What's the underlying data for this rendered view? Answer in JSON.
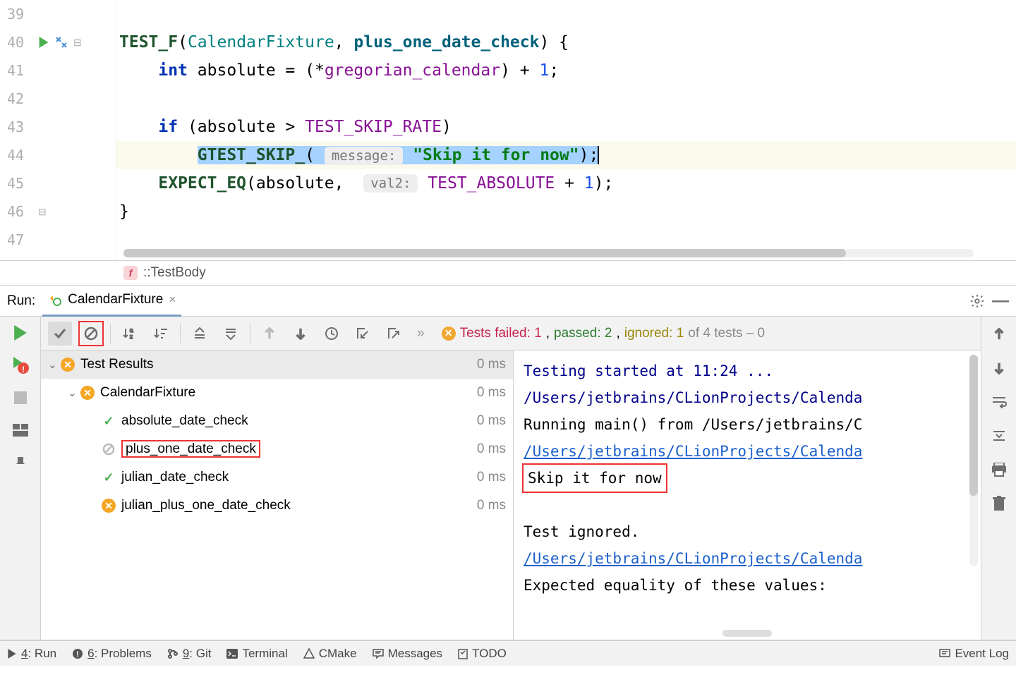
{
  "editor": {
    "lines": [
      {
        "num": "39",
        "indent": "",
        "tokens": []
      },
      {
        "num": "40",
        "indent": "",
        "icons": [
          "run",
          "recompile"
        ],
        "fold": true,
        "tokens": [
          {
            "t": "TEST_F",
            "cls": "kw-macro"
          },
          {
            "t": "("
          },
          {
            "t": "CalendarFixture",
            "cls": "kw-teal"
          },
          {
            "t": ", "
          },
          {
            "t": "plus_one_date_check",
            "cls": "kw-green"
          },
          {
            "t": ") {"
          }
        ]
      },
      {
        "num": "41",
        "indent": "    ",
        "tokens": [
          {
            "t": "int",
            "cls": "kw-blue"
          },
          {
            "t": " absolute = (*"
          },
          {
            "t": "gregorian_calendar",
            "cls": "kw-purple"
          },
          {
            "t": ") + "
          },
          {
            "t": "1",
            "cls": "kw-num"
          },
          {
            "t": ";"
          }
        ]
      },
      {
        "num": "42",
        "indent": "",
        "tokens": []
      },
      {
        "num": "43",
        "indent": "    ",
        "tokens": [
          {
            "t": "if",
            "cls": "kw-blue"
          },
          {
            "t": " (absolute > "
          },
          {
            "t": "TEST_SKIP_RATE",
            "cls": "kw-purple"
          },
          {
            "t": ")"
          }
        ]
      },
      {
        "num": "44",
        "highlight": true,
        "indent": "        ",
        "tokens": [
          {
            "sel": true,
            "content": [
              {
                "t": "GTEST_SKIP_",
                "cls": "kw-macro"
              },
              {
                "t": "( "
              },
              {
                "hint": "message:"
              },
              {
                "t": " "
              },
              {
                "t": "\"Skip it for now\"",
                "cls": "kw-str"
              },
              {
                "t": ");"
              }
            ]
          },
          {
            "caret": true
          }
        ]
      },
      {
        "num": "45",
        "indent": "    ",
        "tokens": [
          {
            "t": "EXPECT_EQ",
            "cls": "kw-macro"
          },
          {
            "t": "(absolute,  "
          },
          {
            "hint": "val2:"
          },
          {
            "t": " "
          },
          {
            "t": "TEST_ABSOLUTE",
            "cls": "kw-purple"
          },
          {
            "t": " + "
          },
          {
            "t": "1",
            "cls": "kw-num"
          },
          {
            "t": ");"
          }
        ]
      },
      {
        "num": "46",
        "indent": "",
        "fold_close": true,
        "tokens": [
          {
            "t": "}"
          }
        ]
      },
      {
        "num": "47",
        "indent": "",
        "tokens": []
      }
    ]
  },
  "breadcrumb": {
    "label": "::TestBody"
  },
  "run": {
    "label": "Run:",
    "tab_name": "CalendarFixture",
    "status": {
      "failed_label": "Tests failed:",
      "failed": "1",
      "passed_label": "passed:",
      "passed": "2",
      "ignored_label": "ignored:",
      "ignored": "1",
      "total_suffix": "of 4 tests – 0"
    },
    "tree": {
      "root": {
        "label": "Test Results",
        "time": "0 ms"
      },
      "suite": {
        "label": "CalendarFixture",
        "time": "0 ms"
      },
      "tests": [
        {
          "name": "absolute_date_check",
          "status": "pass",
          "time": "0 ms"
        },
        {
          "name": "plus_one_date_check",
          "status": "skip",
          "time": "0 ms",
          "highlight": true
        },
        {
          "name": "julian_date_check",
          "status": "pass",
          "time": "0 ms"
        },
        {
          "name": "julian_plus_one_date_check",
          "status": "fail",
          "time": "0 ms"
        }
      ]
    },
    "console": {
      "lines": [
        {
          "text": "Testing started at 11:24 ...",
          "cls": "navyline"
        },
        {
          "text": "/Users/jetbrains/CLionProjects/Calenda",
          "cls": "navyline"
        },
        {
          "text": "Running main() from /Users/jetbrains/C"
        },
        {
          "text": "/Users/jetbrains/CLionProjects/Calenda",
          "cls": "link"
        },
        {
          "text": "Skip it for now",
          "redbox": true
        },
        {
          "text": ""
        },
        {
          "text": "Test ignored."
        },
        {
          "text": "/Users/jetbrains/CLionProjects/Calenda",
          "cls": "link"
        },
        {
          "text": "Expected equality of these values:"
        }
      ]
    }
  },
  "bottom_bar": {
    "items": [
      {
        "icon": "run",
        "key": "4",
        "label": ": Run"
      },
      {
        "icon": "problems",
        "key": "6",
        "label": ": Problems"
      },
      {
        "icon": "git",
        "key": "9",
        "label": ": Git"
      },
      {
        "icon": "terminal",
        "label": " Terminal"
      },
      {
        "icon": "cmake",
        "label": " CMake"
      },
      {
        "icon": "messages",
        "label": " Messages"
      },
      {
        "icon": "todo",
        "label": " TODO"
      }
    ],
    "right": {
      "label": " Event Log"
    }
  }
}
